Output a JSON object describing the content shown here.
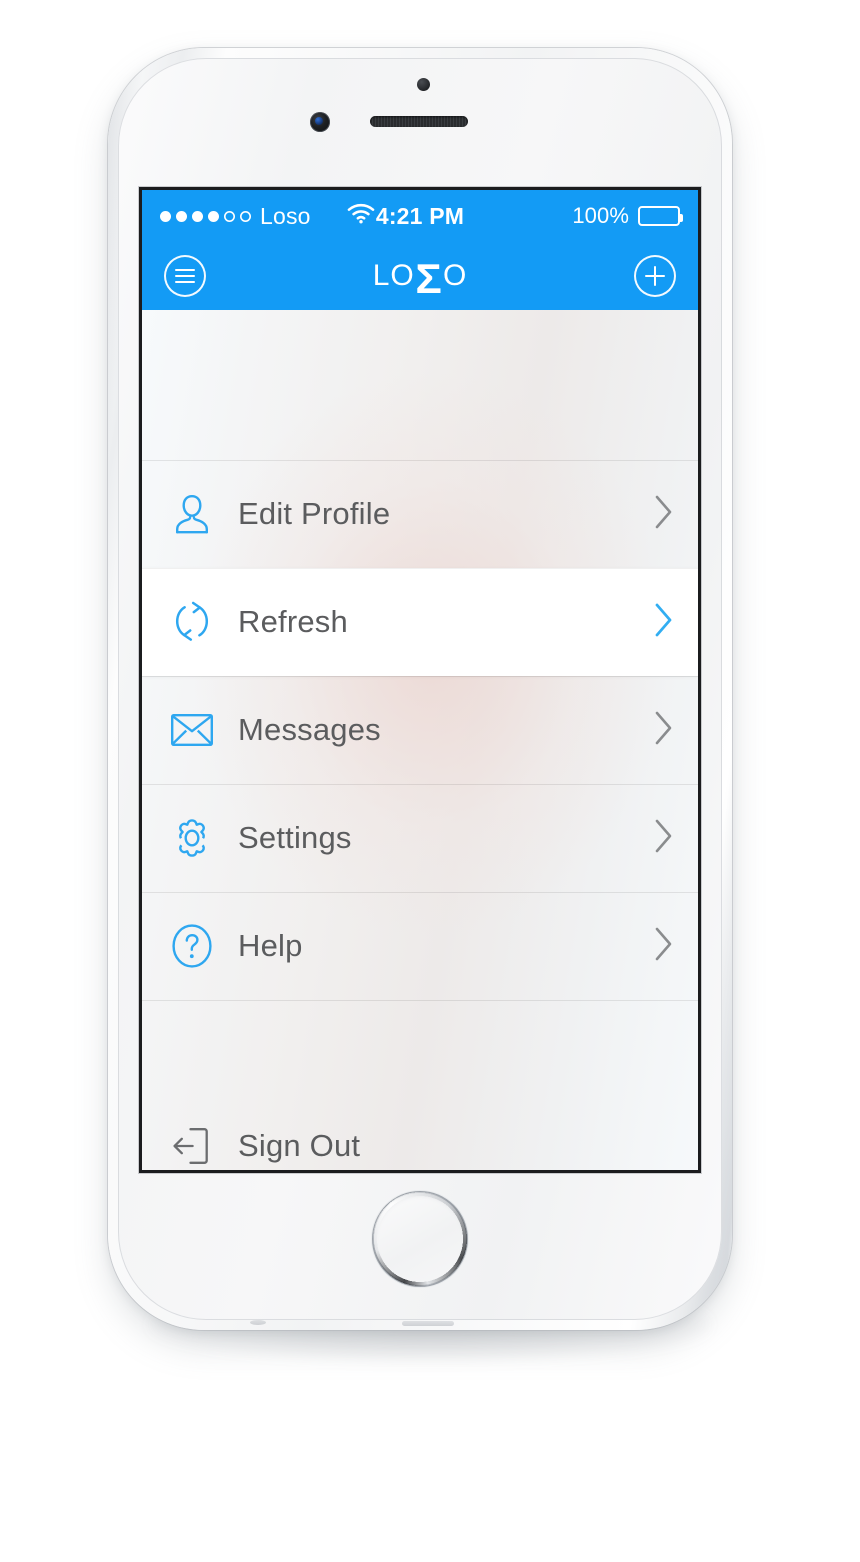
{
  "device": {
    "name": "iphone-6-white-silver",
    "frame_color": "#f2f3f4"
  },
  "status_bar": {
    "carrier": "Loso",
    "signal_dots_filled": 4,
    "signal_dots_total": 6,
    "wifi_icon": "wifi-icon",
    "time": "4:21 PM",
    "battery_percent": "100%",
    "battery_level": 100,
    "background_color": "#139bf5",
    "foreground_color": "#ffffff"
  },
  "nav_bar": {
    "menu_button": {
      "icon": "hamburger-menu-icon",
      "label": "Menu"
    },
    "add_button": {
      "icon": "plus-circle-icon",
      "label": "Add"
    },
    "logo": {
      "prefix": "LO",
      "mark": "Ʃ",
      "suffix": "O",
      "full_text": "LOȘO"
    },
    "background_color": "#139bf5"
  },
  "menu": {
    "accent_color": "#2EA7F0",
    "text_color": "#5b5c5e",
    "items": [
      {
        "id": "edit-profile",
        "label": "Edit Profile",
        "icon": "user-icon",
        "icon_color": "#2EA7F0",
        "chevron": "chevron-right-icon",
        "chevron_color": "#8a8c8e",
        "active": false,
        "has_chevron": true
      },
      {
        "id": "refresh",
        "label": "Refresh",
        "icon": "refresh-icon",
        "icon_color": "#2EA7F0",
        "chevron": "chevron-right-icon",
        "chevron_color": "#32AEF2",
        "active": true,
        "has_chevron": true
      },
      {
        "id": "messages",
        "label": "Messages",
        "icon": "envelope-icon",
        "icon_color": "#2EA7F0",
        "chevron": "chevron-right-icon",
        "chevron_color": "#8a8c8e",
        "active": false,
        "has_chevron": true
      },
      {
        "id": "settings",
        "label": "Settings",
        "icon": "gear-icon",
        "icon_color": "#2EA7F0",
        "chevron": "chevron-right-icon",
        "chevron_color": "#8a8c8e",
        "active": false,
        "has_chevron": true
      },
      {
        "id": "help",
        "label": "Help",
        "icon": "question-circle-icon",
        "icon_color": "#2EA7F0",
        "chevron": "chevron-right-icon",
        "chevron_color": "#8a8c8e",
        "active": false,
        "has_chevron": true
      }
    ],
    "footer_item": {
      "id": "sign-out",
      "label": "Sign Out",
      "icon": "sign-out-icon",
      "icon_color": "#6b6d6f",
      "has_chevron": false,
      "active": false
    }
  }
}
